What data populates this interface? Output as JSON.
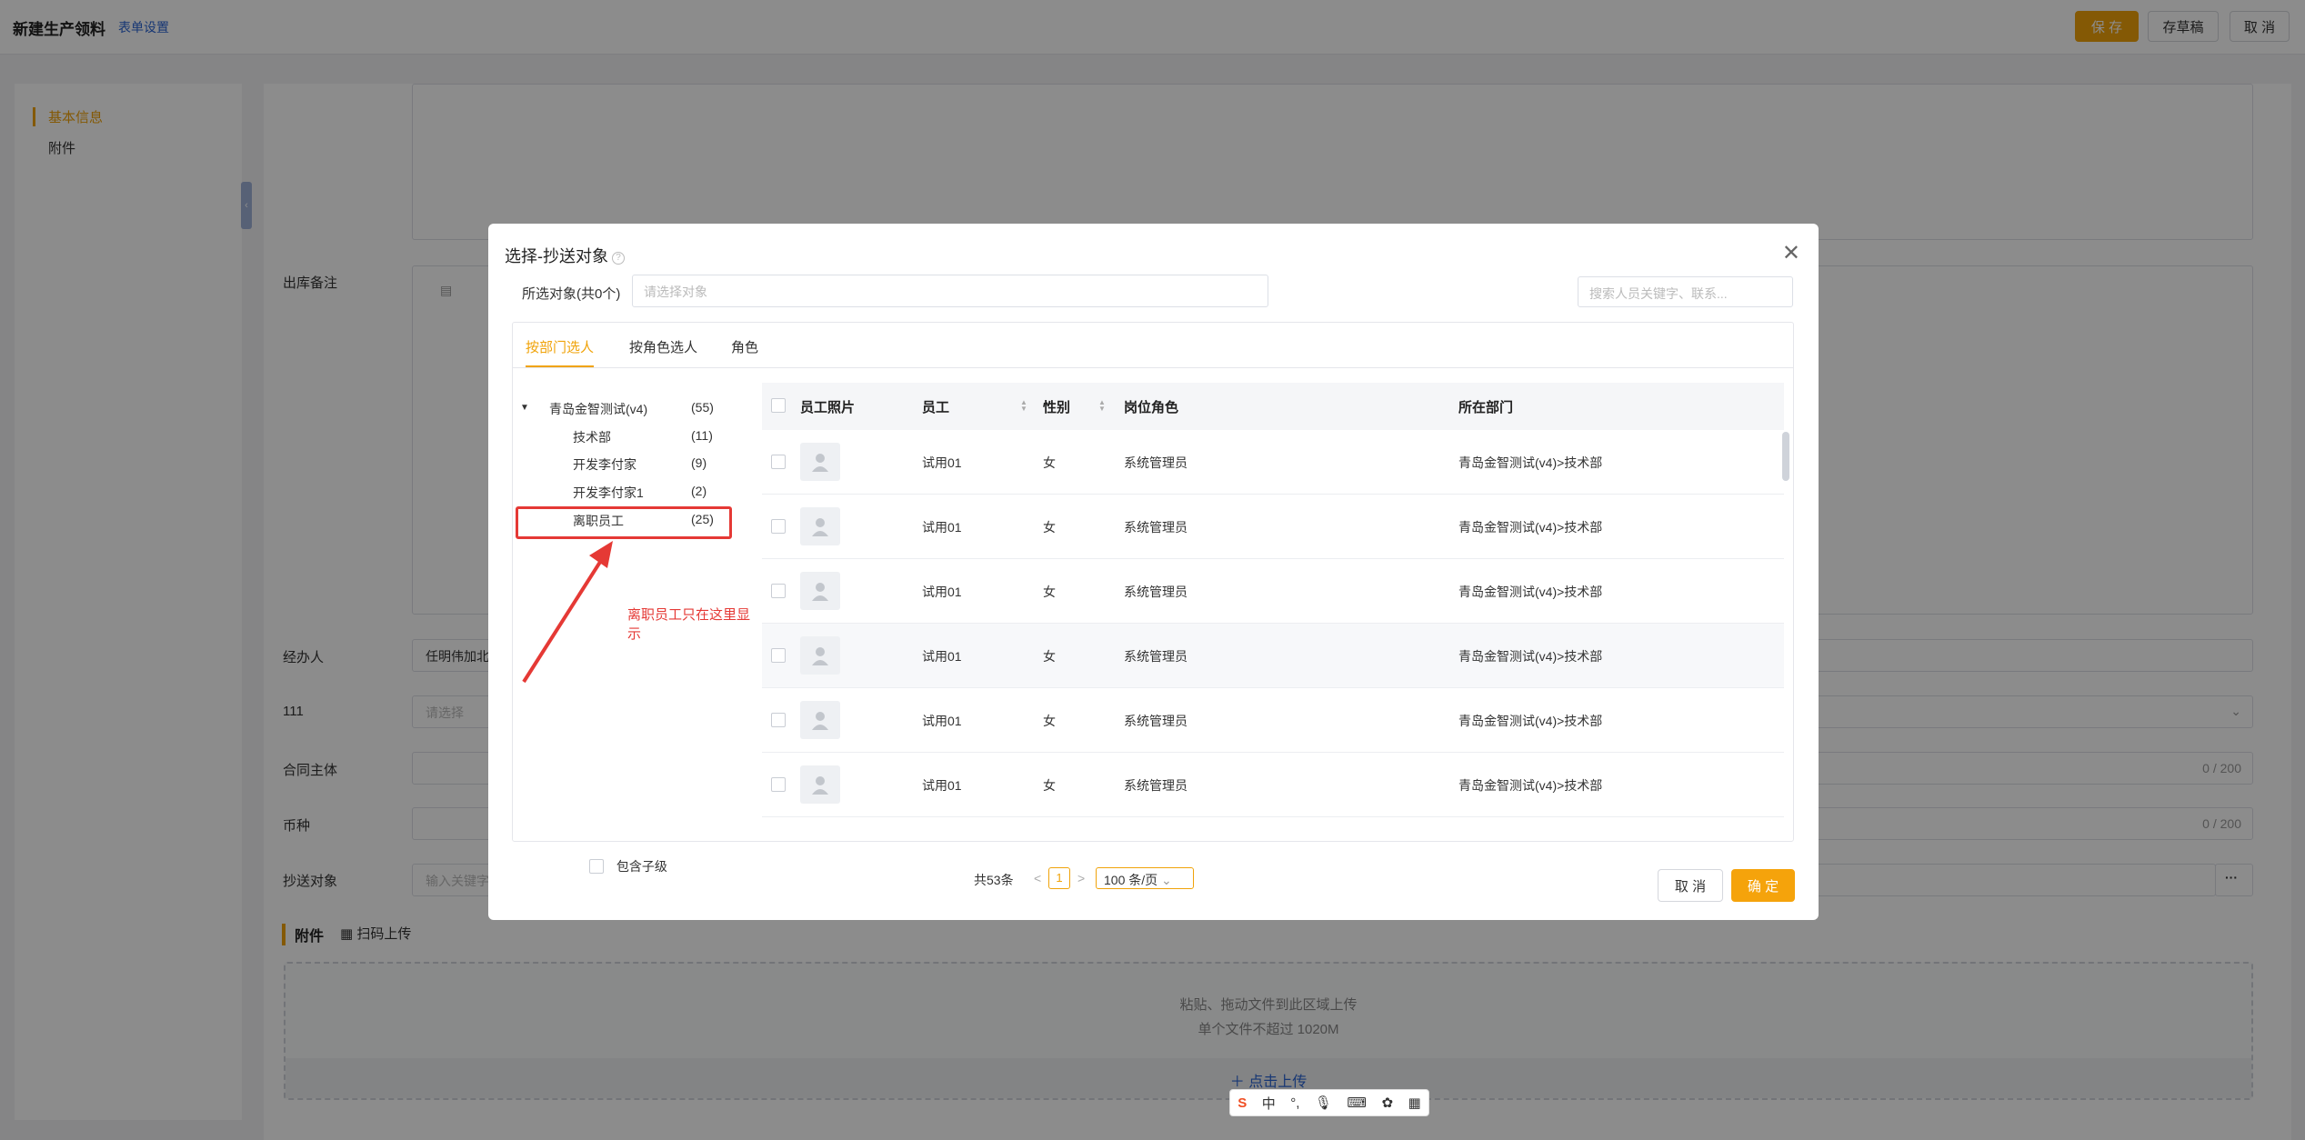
{
  "header": {
    "title": "新建生产领料",
    "form_settings": "表单设置",
    "save": "保 存",
    "draft": "存草稿",
    "cancel": "取 消"
  },
  "left_nav": {
    "items": [
      {
        "label": "基本信息"
      },
      {
        "label": "附件"
      }
    ]
  },
  "form": {
    "outbound_note_label": "出库备注",
    "handler_label": "经办人",
    "handler_value": "任明伟加北",
    "field_111_label": "111",
    "field_111_placeholder": "请选择",
    "contract_label": "合同主体",
    "contract_counter": "0 / 200",
    "currency_label": "币种",
    "currency_counter": "0 / 200",
    "cc_label": "抄送对象",
    "cc_placeholder": "输入关键字",
    "cc_more": "···",
    "attachments_title": "附件",
    "scan_upload": "扫码上传",
    "drop_hint": "粘贴、拖动文件到此区域上传",
    "size_hint": "单个文件不超过 1020M",
    "click_upload": "＋ 点击上传"
  },
  "modal": {
    "title": "选择-抄送对象",
    "selected_label": "所选对象(共0个)",
    "selected_placeholder": "请选择对象",
    "search_placeholder": "搜索人员关键字、联系...",
    "tabs": [
      "按部门选人",
      "按角色选人",
      "角色"
    ],
    "tree": {
      "root": {
        "label": "青岛金智测试(v4)",
        "count": "(55)"
      },
      "children": [
        {
          "label": "技术部",
          "count": "(11)"
        },
        {
          "label": "开发李付家",
          "count": "(9)"
        },
        {
          "label": "开发李付家1",
          "count": "(2)"
        },
        {
          "label": "离职员工",
          "count": "(25)"
        }
      ],
      "include_sub": "包含子级"
    },
    "annotation": "离职员工只在这里显示",
    "columns": [
      "员工照片",
      "员工",
      "性别",
      "岗位角色",
      "所在部门"
    ],
    "rows": [
      {
        "name": "试用01",
        "gender": "女",
        "role": "系统管理员",
        "dept": "青岛金智测试(v4)>技术部"
      },
      {
        "name": "试用01",
        "gender": "女",
        "role": "系统管理员",
        "dept": "青岛金智测试(v4)>技术部"
      },
      {
        "name": "试用01",
        "gender": "女",
        "role": "系统管理员",
        "dept": "青岛金智测试(v4)>技术部"
      },
      {
        "name": "试用01",
        "gender": "女",
        "role": "系统管理员",
        "dept": "青岛金智测试(v4)>技术部"
      },
      {
        "name": "试用01",
        "gender": "女",
        "role": "系统管理员",
        "dept": "青岛金智测试(v4)>技术部"
      },
      {
        "name": "试用01",
        "gender": "女",
        "role": "系统管理员",
        "dept": "青岛金智测试(v4)>技术部"
      }
    ],
    "pager": {
      "total": "共53条",
      "prev": "<",
      "page": "1",
      "next": ">",
      "page_size": "100 条/页"
    },
    "cancel": "取 消",
    "ok": "确 定"
  },
  "ime_bar": {
    "logo": "S",
    "mode": "中"
  },
  "colors": {
    "accent": "#f0a30a",
    "link": "#2b64d4",
    "annotation": "#e53935"
  }
}
